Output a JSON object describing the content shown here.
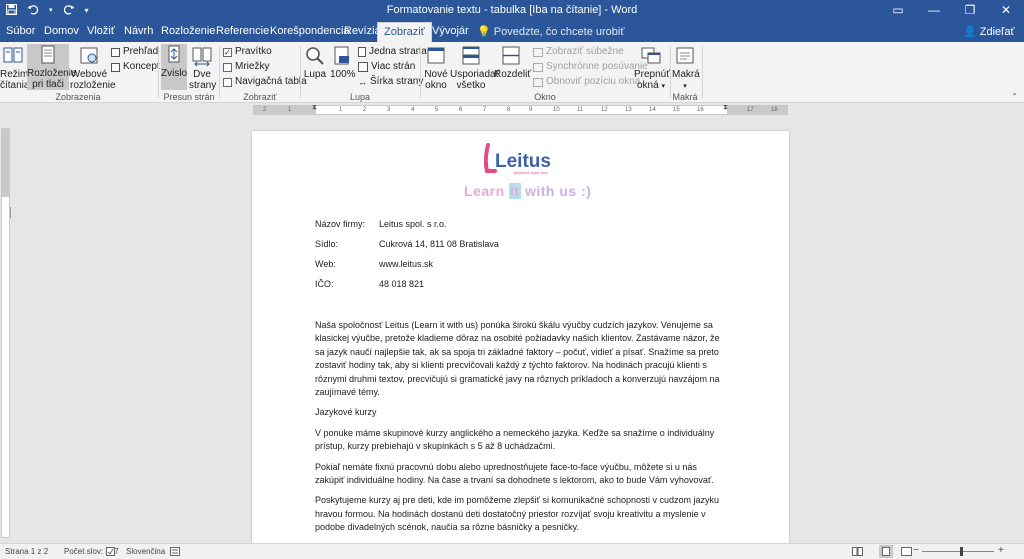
{
  "window": {
    "title": "Formatovanie textu - tabulka [Iba na čítanie] - Word",
    "buttons": [
      "—",
      "❐",
      "✕"
    ],
    "options_icon": "▭"
  },
  "qat": {
    "save_icon": "save-icon",
    "undo_icon": "undo-icon",
    "redo_icon": "redo-icon",
    "customize_icon": "customize-icon"
  },
  "tabs": [
    "Súbor",
    "Domov",
    "Vložiť",
    "Návrh",
    "Rozloženie",
    "Referencie",
    "Korešpondencia",
    "Revízia",
    "Zobraziť",
    "Vývojár"
  ],
  "active_tab": "Zobraziť",
  "tell_me": "Povedzte, čo chcete urobiť",
  "share": "Zdieľať",
  "ribbon": {
    "zobrazenia": {
      "label": "Zobrazenia",
      "rezim_line1": "Režim",
      "rezim_line2": "čítania",
      "rozlozenie_line1": "Rozloženie",
      "rozlozenie_line2": "pri tlači",
      "webove_line1": "Webové",
      "webove_line2": "rozloženie",
      "prehlad": "Prehľad",
      "koncept": "Koncept"
    },
    "presun": {
      "label": "Presun strán",
      "zvislo": "Zvislo",
      "dve_line1": "Dve",
      "dve_line2": "strany"
    },
    "zobrazit": {
      "label": "Zobraziť",
      "pravitko": "Pravítko",
      "mriezky": "Mriežky",
      "navigacna": "Navigačná tabla"
    },
    "lupa": {
      "label": "Lupa",
      "lupa": "Lupa",
      "percent": "100%",
      "jedna": "Jedna strana",
      "viac": "Viac strán",
      "sirka": "Šírka strany"
    },
    "okno": {
      "label": "Okno",
      "nove_line1": "Nové",
      "nove_line2": "okno",
      "usporiadat_line1": "Usporiadať",
      "usporiadat_line2": "všetko",
      "rozdelit": "Rozdeliť",
      "subezne": "Zobraziť súbežne",
      "synchronne": "Synchrónne posúvanie",
      "obnovit": "Obnoviť pozíciu okna",
      "prepnut_line1": "Prepnúť",
      "prepnut_line2": "okná"
    },
    "makra": {
      "label": "Makrá",
      "makra": "Makrá"
    }
  },
  "ruler": {
    "ticks": [
      "2",
      "1",
      "1",
      "2",
      "3",
      "4",
      "5",
      "6",
      "7",
      "8",
      "9",
      "10",
      "11",
      "12",
      "13",
      "14",
      "15",
      "16",
      "17",
      "18"
    ]
  },
  "document": {
    "logo_text": "Leitus",
    "logo_sub": "jazykové a pre ľudí",
    "tagline_part1": "Learn",
    "tagline_part2": "it",
    "tagline_part3": "with",
    "tagline_part4": "us",
    "tagline_part5": ":)",
    "info": [
      {
        "key": "Názov firmy:",
        "value": "Leitus spol. s r.o."
      },
      {
        "key": "Sídlo:",
        "value": "Cukrová 14, 811 08 Bratislava"
      },
      {
        "key": "Web:",
        "value": "www.leitus.sk"
      },
      {
        "key": "IČO:",
        "value": "48 018 821"
      }
    ],
    "paragraphs": [
      "Naša spoločnosť Leitus (Learn it with us) ponúka širokú škálu výučby cudzích jazykov. Venujeme sa klasickej výučbe, pretože kladieme dôraz na osobité požiadavky našich klientov. Zastávame názor, že sa jazyk naučí najlepšie tak, ak sa spoja tri základné faktory – počuť, vidieť a písať. Snažíme sa preto zostaviť hodiny tak, aby si klienti precvičovali každý z týchto faktorov. Na hodinách pracujú klienti s rôznymi druhmi textov, precvičujú si gramatické javy na rôznych príkladoch a konverzujú navzájom na zaujímavé témy.",
      "Jazykové kurzy",
      "V ponuke máme skupinové kurzy anglického a nemeckého jazyka. Keďže sa snažíme o individuálny prístup, kurzy prebiehajú v skupinkách s 5 až 8 uchádzačmi.",
      "Pokiaľ nemáte fixnú pracovnú dobu alebo uprednostňujete face-to-face výučbu, môžete si u nás zakúpiť individuálne hodiny. Na čase a trvaní sa dohodnete s lektorom, ako to bude Vám vyhovovať.",
      "Poskytujeme kurzy aj pre deti, kde im pomôžeme zlepšiť si komunikačné schopnosti v cudzom jazyku hravou formou. Na hodinách dostanú deti dostatočný priestor rozvíjať svoju kreativitu a myslenie v podobe divadelných scénok, naučia sa rôzne básničky a pesničky."
    ]
  },
  "status": {
    "page": "Strana 1 z 2",
    "words": "Počet slov: 447",
    "language": "Slovenčina"
  },
  "colors": {
    "word_blue": "#2b579a",
    "logo_blue": "#3b5fa8",
    "logo_pink": "#e24a8b"
  }
}
